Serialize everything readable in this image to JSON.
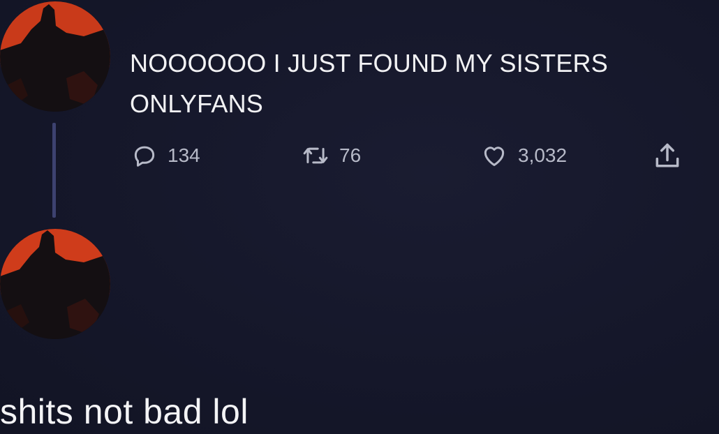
{
  "tweet": {
    "text_line_1": "NOOOOOO I JUST FOUND MY SISTERS",
    "text_line_2": "ONLYFANS",
    "reply_count": "134",
    "retweet_count": "76",
    "like_count": "3,032"
  },
  "reply": {
    "text": "shits not bad lol"
  },
  "icons": {
    "reply": "reply-icon",
    "retweet": "retweet-icon",
    "like": "heart-icon",
    "share": "share-icon"
  },
  "colors": {
    "background": "#15172a",
    "thread_line": "#3d4270",
    "avatar_sky": "#d4401c",
    "text": "#f2f2f4",
    "action_text": "#b7bac8"
  }
}
